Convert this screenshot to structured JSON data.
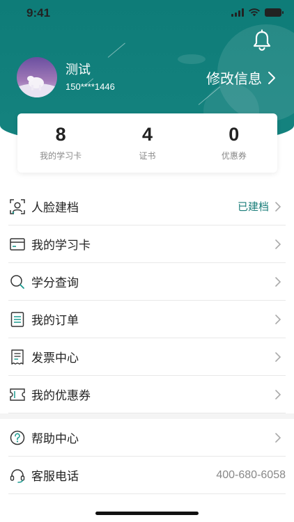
{
  "status_bar": {
    "time": "9:41"
  },
  "profile": {
    "name": "测试",
    "phone": "150****1446",
    "edit_label": "修改信息"
  },
  "stats": [
    {
      "value": "8",
      "label": "我的学习卡"
    },
    {
      "value": "4",
      "label": "证书"
    },
    {
      "value": "0",
      "label": "优惠券"
    }
  ],
  "menu_primary": [
    {
      "label": "人脸建档",
      "value": "已建档",
      "icon": "face-scan-icon"
    },
    {
      "label": "我的学习卡",
      "icon": "card-icon"
    },
    {
      "label": "学分查询",
      "icon": "search-icon"
    },
    {
      "label": "我的订单",
      "icon": "order-list-icon"
    },
    {
      "label": "发票中心",
      "icon": "invoice-icon"
    },
    {
      "label": "我的优惠券",
      "icon": "coupon-icon"
    }
  ],
  "menu_secondary": [
    {
      "label": "帮助中心",
      "icon": "help-icon"
    },
    {
      "label": "客服电话",
      "value": "400-680-6058",
      "icon": "headset-icon"
    }
  ],
  "colors": {
    "brand": "#0e7c78",
    "accent_text": "#1a7d79",
    "divider": "#e8e8e8"
  }
}
